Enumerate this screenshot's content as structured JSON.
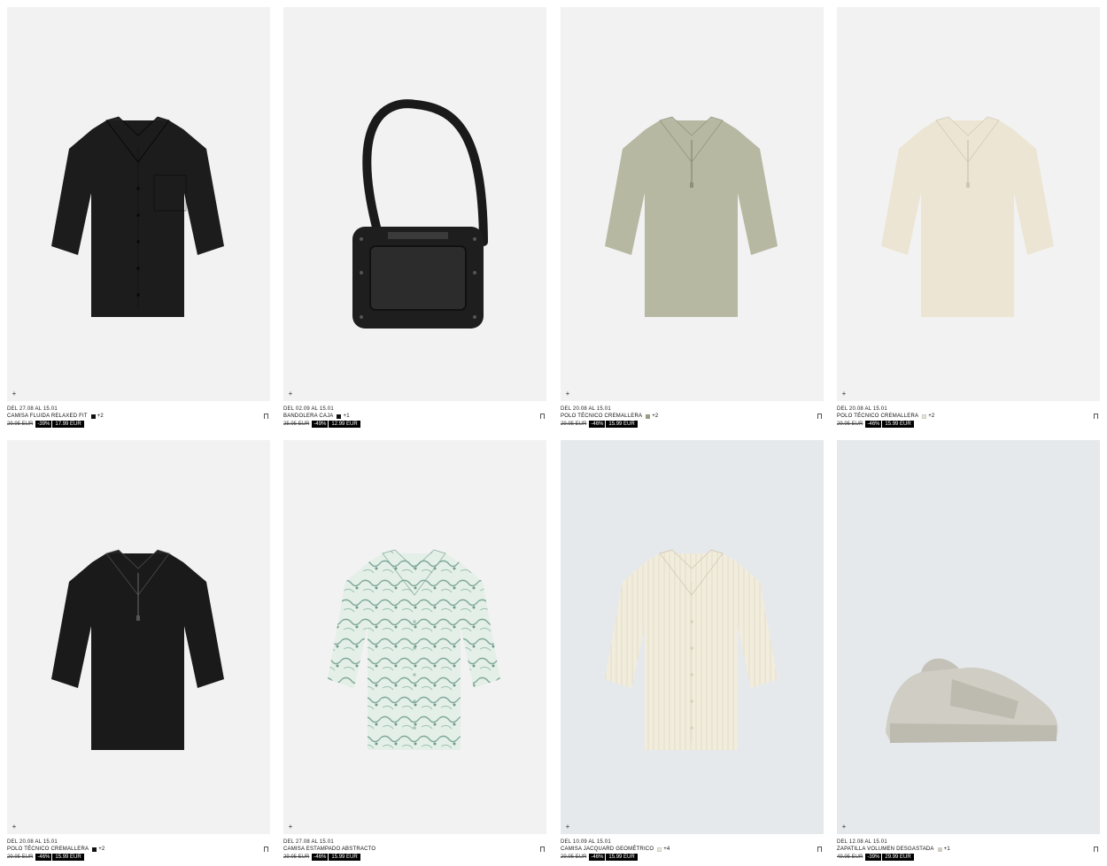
{
  "products": [
    {
      "dates": "DEL 27.08 AL 15.01",
      "name": "CAMISA FLUIDA RELAXED FIT",
      "swatch_color": "#111111",
      "swatch_count": "+2",
      "old_price": "29.95 EUR",
      "discount": "-39%",
      "price": "17.99 EUR",
      "image": "black-shirt"
    },
    {
      "dates": "DEL 02.09 AL 15.01",
      "name": "BANDOLERA CAJA",
      "swatch_color": "#111111",
      "swatch_count": "+1",
      "old_price": "25.95 EUR",
      "discount": "-49%",
      "price": "12.99 EUR",
      "image": "black-bag"
    },
    {
      "dates": "DEL 20.08 AL 15.01",
      "name": "POLO TÉCNICO CREMALLERA",
      "swatch_color": "#9a9c85",
      "swatch_count": "+2",
      "old_price": "29.95 EUR",
      "discount": "-46%",
      "price": "15.99 EUR",
      "image": "khaki-polo"
    },
    {
      "dates": "DEL 20.08 AL 15.01",
      "name": "POLO TÉCNICO CREMALLERA",
      "swatch_color": "#e9e2d1",
      "swatch_count": "+2",
      "old_price": "29.95 EUR",
      "discount": "-46%",
      "price": "15.99 EUR",
      "image": "cream-polo"
    },
    {
      "dates": "DEL 20.08 AL 15.01",
      "name": "POLO TÉCNICO CREMALLERA",
      "swatch_color": "#111111",
      "swatch_count": "+2",
      "old_price": "29.95 EUR",
      "discount": "-46%",
      "price": "15.99 EUR",
      "image": "black-polo"
    },
    {
      "dates": "DEL 27.08 AL 15.01",
      "name": "CAMISA ESTAMPADO ABSTRACTO",
      "swatch_color": "",
      "swatch_count": "",
      "old_price": "29.95 EUR",
      "discount": "-46%",
      "price": "15.99 EUR",
      "image": "print-shirt"
    },
    {
      "dates": "DEL 10.09 AL 15.01",
      "name": "CAMISA JACQUARD GEOMÉTRICO",
      "swatch_color": "#efe9da",
      "swatch_count": "+4",
      "old_price": "29.95 EUR",
      "discount": "-46%",
      "price": "15.99 EUR",
      "image": "cream-shirt"
    },
    {
      "dates": "DEL 12.08 AL 15.01",
      "name": "ZAPATILLA VOLUMEN DESGASTADA",
      "swatch_color": "#cfcdc4",
      "swatch_count": "+1",
      "old_price": "49.95 EUR",
      "discount": "-39%",
      "price": "29.99 EUR",
      "image": "sneaker"
    }
  ],
  "plus_icon": "+",
  "colors": {
    "media_bg": "#f2f2f2",
    "media_bg_cool": "#e6e9eb",
    "badge_bg": "#000000"
  }
}
